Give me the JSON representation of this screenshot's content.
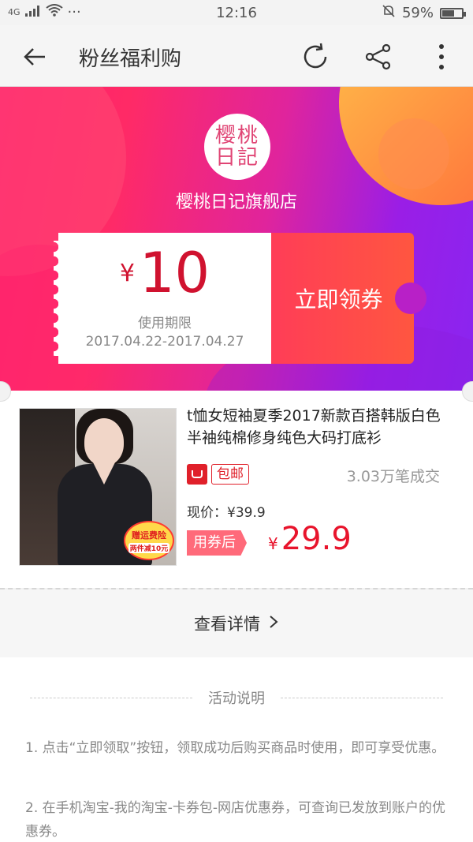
{
  "status_bar": {
    "signal": "4G",
    "time": "12:16",
    "battery": "59%",
    "battery_level": 0.59,
    "left_dots": "···"
  },
  "app_bar": {
    "title": "粉丝福利购",
    "icons": [
      "back-arrow-icon",
      "refresh-icon",
      "share-icon",
      "more-icon"
    ]
  },
  "banner": {
    "logo_text": "樱桃日記",
    "shop_name": "樱桃日记旗舰店",
    "coupon": {
      "currency": "¥",
      "amount": "10",
      "validity_label": "使用期限",
      "validity": "2017.04.22-2017.04.27",
      "claim_label": "立即领券"
    }
  },
  "product": {
    "title": "t恤女短袖夏季2017新款百搭韩版白色半袖纯棉修身纯色大码打底衫",
    "image_badge_line1": "赠运费险",
    "image_badge_line2": "两件减10元",
    "shipping_tag": "包邮",
    "sales": "3.03万笔成交",
    "current_price": "现价：¥39.9",
    "after_coupon_label": "用券后",
    "final_currency": "¥",
    "final_price": "29.9"
  },
  "details": {
    "label": "查看详情",
    "chevron": "›"
  },
  "description": {
    "title": "活动说明",
    "items": [
      "1. 点击“立即领取”按钮，领取成功后购买商品时使用，即可享受优惠。",
      "2. 在手机淘宝-我的淘宝-卡券包-网店优惠券，可查询已发放到账户的优惠券。"
    ]
  },
  "colors": {
    "accent_red": "#e8142c",
    "banner_pink": "#ff2a66",
    "banner_purple": "#8a25f0"
  }
}
